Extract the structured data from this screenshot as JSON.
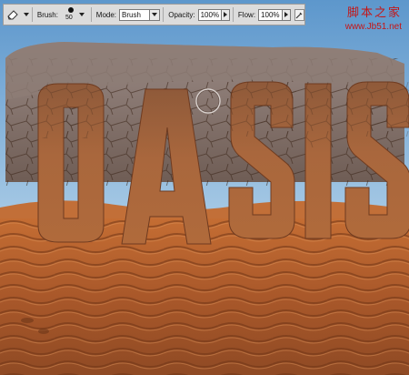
{
  "toolbar": {
    "tool_icon": "eraser-icon",
    "brush_label": "Brush:",
    "brush_size": "50",
    "mode_label": "Mode:",
    "mode_value": "Brush",
    "opacity_label": "Opacity:",
    "opacity_value": "100%",
    "flow_label": "Flow:",
    "flow_value": "100%",
    "airbrush_icon": "airbrush-icon"
  },
  "watermark": {
    "title": "脚本之家",
    "url": "www.Jb51.net"
  },
  "canvas": {
    "artwork_text": "OASIS",
    "cursor_icon": "brush-cursor-icon"
  },
  "colors": {
    "sky": "#6ea3d2",
    "sand": "#b8622c",
    "letter_face": "#a9653a",
    "rock_top": "#8a7a74",
    "watermark": "#c51616"
  }
}
